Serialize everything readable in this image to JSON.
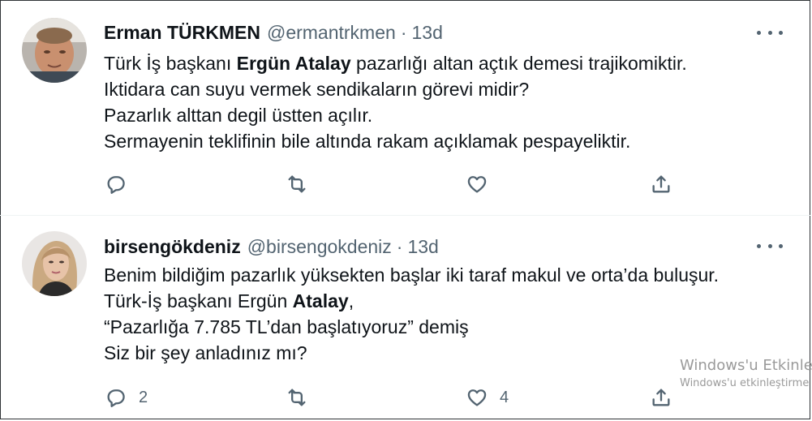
{
  "tweets": [
    {
      "display_name": "Erman TÜRKMEN",
      "handle": "@ermantrkmen",
      "separator": "·",
      "time": "13d",
      "lines": [
        {
          "pre": "Türk İş başkanı ",
          "bold": "Ergün Atalay",
          "post": "  pazarlığı altan açtık demesi trajikomiktir."
        },
        {
          "pre": "Iktidara can suyu vermek sendikaların görevi midir?",
          "bold": "",
          "post": ""
        },
        {
          "pre": "Pazarlık alttan degil üstten açılır.",
          "bold": "",
          "post": ""
        },
        {
          "pre": "Sermayenin teklifinin bile altında rakam açıklamak pespayeliktir.",
          "bold": "",
          "post": ""
        }
      ],
      "reply_count": "",
      "retweet_count": "",
      "like_count": ""
    },
    {
      "display_name": "birsengökdeniz",
      "handle": "@birsengokdeniz",
      "separator": "·",
      "time": "13d",
      "lines": [
        {
          "pre": "Benim bildiğim pazarlık yüksekten başlar iki taraf makul ve orta’da buluşur.",
          "bold": "",
          "post": ""
        },
        {
          "pre": "Türk-İş başkanı Ergün ",
          "bold": "Atalay",
          "post": ","
        },
        {
          "pre": "“Pazarlığa 7.785 TL’dan başlatıyoruz” demiş",
          "bold": "",
          "post": ""
        },
        {
          "pre": "Siz bir şey anladınız mı?",
          "bold": "",
          "post": ""
        }
      ],
      "reply_count": "2",
      "retweet_count": "",
      "like_count": "4"
    }
  ],
  "icons": {
    "reply": "reply-icon",
    "retweet": "retweet-icon",
    "like": "heart-icon",
    "share": "share-icon",
    "more": "more-icon"
  },
  "watermark": {
    "line1": "Windows'u Etkinleş",
    "line2": "Windows'u etkinleştirme"
  },
  "colors": {
    "text": "#0f1419",
    "secondary": "#536471",
    "divider": "#eff3f4"
  }
}
